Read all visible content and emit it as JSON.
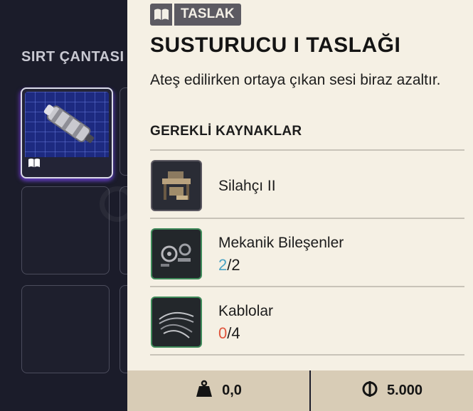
{
  "backpack": {
    "title": "SIRT ÇANTASI"
  },
  "tooltip": {
    "tag_icon": "open-book-icon",
    "tag_label": "TASLAK",
    "title": "SUSTURUCU I TASLAĞI",
    "description": "Ateş edilirken ortaya çıkan sesi biraz azaltır.",
    "requirements_heading": "GEREKLİ KAYNAKLAR",
    "requirements": [
      {
        "name": "Silahçı II",
        "icon": "workbench-icon"
      },
      {
        "name": "Mekanik Bileşenler",
        "have": "2",
        "sep": "/",
        "need": "2",
        "icon": "mechanical-parts-icon"
      },
      {
        "name": "Kablolar",
        "have": "0",
        "sep": "/",
        "need": "4",
        "icon": "cables-icon"
      }
    ]
  },
  "footer": {
    "weight_icon": "weight-icon",
    "weight": "0,0",
    "currency_icon": "coin-icon",
    "price": "5.000"
  },
  "colors": {
    "panel_bg": "#f5f0e4",
    "footer_bg": "#d8ccb6",
    "have_ok": "#4aa3c4",
    "have_missing": "#e0553d",
    "tag_bg": "#5c5a62",
    "bg": "#1b1c2a"
  }
}
